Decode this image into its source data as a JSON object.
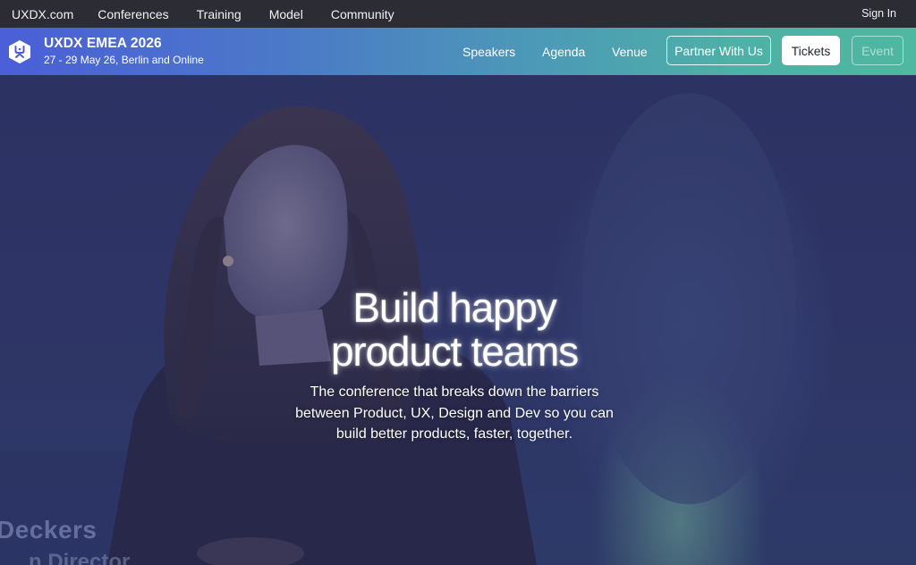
{
  "topnav": {
    "brand": "UXDX.com",
    "links": [
      "Conferences",
      "Training",
      "Model",
      "Community"
    ],
    "signin": "Sign In"
  },
  "event": {
    "title": "UXDX EMEA 2026",
    "subtitle": "27 - 29 May 26, Berlin and Online",
    "nav": [
      "Speakers",
      "Agenda",
      "Venue"
    ],
    "partner_button": "Partner With Us",
    "tickets_button": "Tickets",
    "event_button": "Event",
    "colors": {
      "gradient_start": "#4b5fd8",
      "gradient_end": "#4fb8a0"
    }
  },
  "hero": {
    "headline_line1": "Build happy",
    "headline_line2": "product teams",
    "sub_line1": "The conference that breaks down the barriers",
    "sub_line2": "between Product, UX, Design and Dev so you can",
    "sub_line3": "build better products, faster, together.",
    "speaker_name_fragment": "Deckers",
    "speaker_role_fragment": "n Director"
  }
}
